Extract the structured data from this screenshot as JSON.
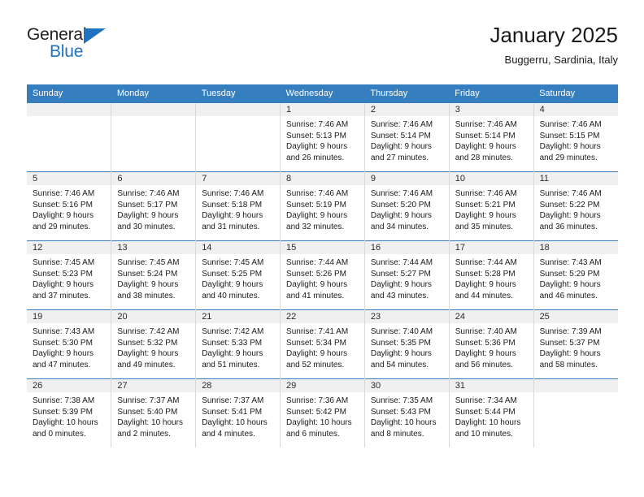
{
  "brand": {
    "name_part1": "General",
    "name_part2": "Blue",
    "logo_icon": "triangle-logo-icon",
    "colors": {
      "blue": "#1f72bd",
      "dark": "#231f20"
    }
  },
  "header": {
    "title": "January 2025",
    "subtitle": "Buggerru, Sardinia, Italy"
  },
  "calendar": {
    "header_bg": "#357ec0",
    "daynum_bg": "#f0f0f0",
    "weekdays": [
      "Sunday",
      "Monday",
      "Tuesday",
      "Wednesday",
      "Thursday",
      "Friday",
      "Saturday"
    ],
    "weeks": [
      [
        {
          "day": "",
          "lines": []
        },
        {
          "day": "",
          "lines": []
        },
        {
          "day": "",
          "lines": []
        },
        {
          "day": "1",
          "lines": [
            "Sunrise: 7:46 AM",
            "Sunset: 5:13 PM",
            "Daylight: 9 hours",
            "and 26 minutes."
          ]
        },
        {
          "day": "2",
          "lines": [
            "Sunrise: 7:46 AM",
            "Sunset: 5:14 PM",
            "Daylight: 9 hours",
            "and 27 minutes."
          ]
        },
        {
          "day": "3",
          "lines": [
            "Sunrise: 7:46 AM",
            "Sunset: 5:14 PM",
            "Daylight: 9 hours",
            "and 28 minutes."
          ]
        },
        {
          "day": "4",
          "lines": [
            "Sunrise: 7:46 AM",
            "Sunset: 5:15 PM",
            "Daylight: 9 hours",
            "and 29 minutes."
          ]
        }
      ],
      [
        {
          "day": "5",
          "lines": [
            "Sunrise: 7:46 AM",
            "Sunset: 5:16 PM",
            "Daylight: 9 hours",
            "and 29 minutes."
          ]
        },
        {
          "day": "6",
          "lines": [
            "Sunrise: 7:46 AM",
            "Sunset: 5:17 PM",
            "Daylight: 9 hours",
            "and 30 minutes."
          ]
        },
        {
          "day": "7",
          "lines": [
            "Sunrise: 7:46 AM",
            "Sunset: 5:18 PM",
            "Daylight: 9 hours",
            "and 31 minutes."
          ]
        },
        {
          "day": "8",
          "lines": [
            "Sunrise: 7:46 AM",
            "Sunset: 5:19 PM",
            "Daylight: 9 hours",
            "and 32 minutes."
          ]
        },
        {
          "day": "9",
          "lines": [
            "Sunrise: 7:46 AM",
            "Sunset: 5:20 PM",
            "Daylight: 9 hours",
            "and 34 minutes."
          ]
        },
        {
          "day": "10",
          "lines": [
            "Sunrise: 7:46 AM",
            "Sunset: 5:21 PM",
            "Daylight: 9 hours",
            "and 35 minutes."
          ]
        },
        {
          "day": "11",
          "lines": [
            "Sunrise: 7:46 AM",
            "Sunset: 5:22 PM",
            "Daylight: 9 hours",
            "and 36 minutes."
          ]
        }
      ],
      [
        {
          "day": "12",
          "lines": [
            "Sunrise: 7:45 AM",
            "Sunset: 5:23 PM",
            "Daylight: 9 hours",
            "and 37 minutes."
          ]
        },
        {
          "day": "13",
          "lines": [
            "Sunrise: 7:45 AM",
            "Sunset: 5:24 PM",
            "Daylight: 9 hours",
            "and 38 minutes."
          ]
        },
        {
          "day": "14",
          "lines": [
            "Sunrise: 7:45 AM",
            "Sunset: 5:25 PM",
            "Daylight: 9 hours",
            "and 40 minutes."
          ]
        },
        {
          "day": "15",
          "lines": [
            "Sunrise: 7:44 AM",
            "Sunset: 5:26 PM",
            "Daylight: 9 hours",
            "and 41 minutes."
          ]
        },
        {
          "day": "16",
          "lines": [
            "Sunrise: 7:44 AM",
            "Sunset: 5:27 PM",
            "Daylight: 9 hours",
            "and 43 minutes."
          ]
        },
        {
          "day": "17",
          "lines": [
            "Sunrise: 7:44 AM",
            "Sunset: 5:28 PM",
            "Daylight: 9 hours",
            "and 44 minutes."
          ]
        },
        {
          "day": "18",
          "lines": [
            "Sunrise: 7:43 AM",
            "Sunset: 5:29 PM",
            "Daylight: 9 hours",
            "and 46 minutes."
          ]
        }
      ],
      [
        {
          "day": "19",
          "lines": [
            "Sunrise: 7:43 AM",
            "Sunset: 5:30 PM",
            "Daylight: 9 hours",
            "and 47 minutes."
          ]
        },
        {
          "day": "20",
          "lines": [
            "Sunrise: 7:42 AM",
            "Sunset: 5:32 PM",
            "Daylight: 9 hours",
            "and 49 minutes."
          ]
        },
        {
          "day": "21",
          "lines": [
            "Sunrise: 7:42 AM",
            "Sunset: 5:33 PM",
            "Daylight: 9 hours",
            "and 51 minutes."
          ]
        },
        {
          "day": "22",
          "lines": [
            "Sunrise: 7:41 AM",
            "Sunset: 5:34 PM",
            "Daylight: 9 hours",
            "and 52 minutes."
          ]
        },
        {
          "day": "23",
          "lines": [
            "Sunrise: 7:40 AM",
            "Sunset: 5:35 PM",
            "Daylight: 9 hours",
            "and 54 minutes."
          ]
        },
        {
          "day": "24",
          "lines": [
            "Sunrise: 7:40 AM",
            "Sunset: 5:36 PM",
            "Daylight: 9 hours",
            "and 56 minutes."
          ]
        },
        {
          "day": "25",
          "lines": [
            "Sunrise: 7:39 AM",
            "Sunset: 5:37 PM",
            "Daylight: 9 hours",
            "and 58 minutes."
          ]
        }
      ],
      [
        {
          "day": "26",
          "lines": [
            "Sunrise: 7:38 AM",
            "Sunset: 5:39 PM",
            "Daylight: 10 hours",
            "and 0 minutes."
          ]
        },
        {
          "day": "27",
          "lines": [
            "Sunrise: 7:37 AM",
            "Sunset: 5:40 PM",
            "Daylight: 10 hours",
            "and 2 minutes."
          ]
        },
        {
          "day": "28",
          "lines": [
            "Sunrise: 7:37 AM",
            "Sunset: 5:41 PM",
            "Daylight: 10 hours",
            "and 4 minutes."
          ]
        },
        {
          "day": "29",
          "lines": [
            "Sunrise: 7:36 AM",
            "Sunset: 5:42 PM",
            "Daylight: 10 hours",
            "and 6 minutes."
          ]
        },
        {
          "day": "30",
          "lines": [
            "Sunrise: 7:35 AM",
            "Sunset: 5:43 PM",
            "Daylight: 10 hours",
            "and 8 minutes."
          ]
        },
        {
          "day": "31",
          "lines": [
            "Sunrise: 7:34 AM",
            "Sunset: 5:44 PM",
            "Daylight: 10 hours",
            "and 10 minutes."
          ]
        },
        {
          "day": "",
          "lines": []
        }
      ]
    ]
  }
}
